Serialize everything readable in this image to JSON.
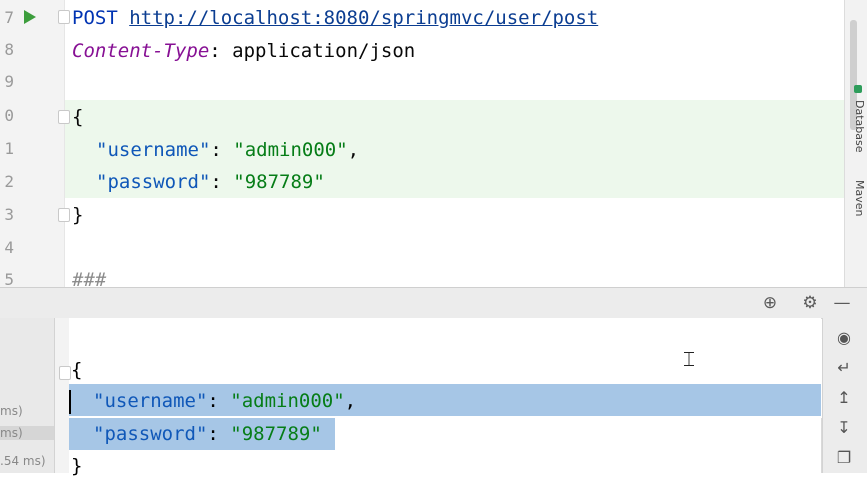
{
  "editor": {
    "line_numbers": [
      "7",
      "8",
      "9",
      "0",
      "1",
      "2",
      "3",
      "4",
      "5"
    ],
    "request_method": "POST",
    "request_url": "http://localhost:8080/springmvc/user/post",
    "header_key": "Content-Type",
    "header_sep": ":",
    "header_value": " application/json",
    "open_brace": "{",
    "body_key_1": "\"username\"",
    "body_val_1": "\"admin000\"",
    "body_key_2": "\"password\"",
    "body_val_2": "\"987789\"",
    "close_brace": "}",
    "separator": "###"
  },
  "side_strip": {
    "label_top": "Database",
    "label_bottom": "Maven"
  },
  "toolbar_icons": [
    "target-icon",
    "gear-icon",
    "minimize-icon"
  ],
  "run_list": {
    "items": [
      "ms)",
      "ms)",
      ".54 ms)"
    ]
  },
  "response": {
    "open_brace": "{",
    "key_1": "\"username\"",
    "val_1": "\"admin000\"",
    "key_2": "\"password\"",
    "val_2": "\"987789\"",
    "close_brace": "}"
  },
  "response_tools": [
    "eye-icon",
    "wrap-icon",
    "scroll-top-icon",
    "scroll-bottom-icon",
    "copy-icon"
  ]
}
